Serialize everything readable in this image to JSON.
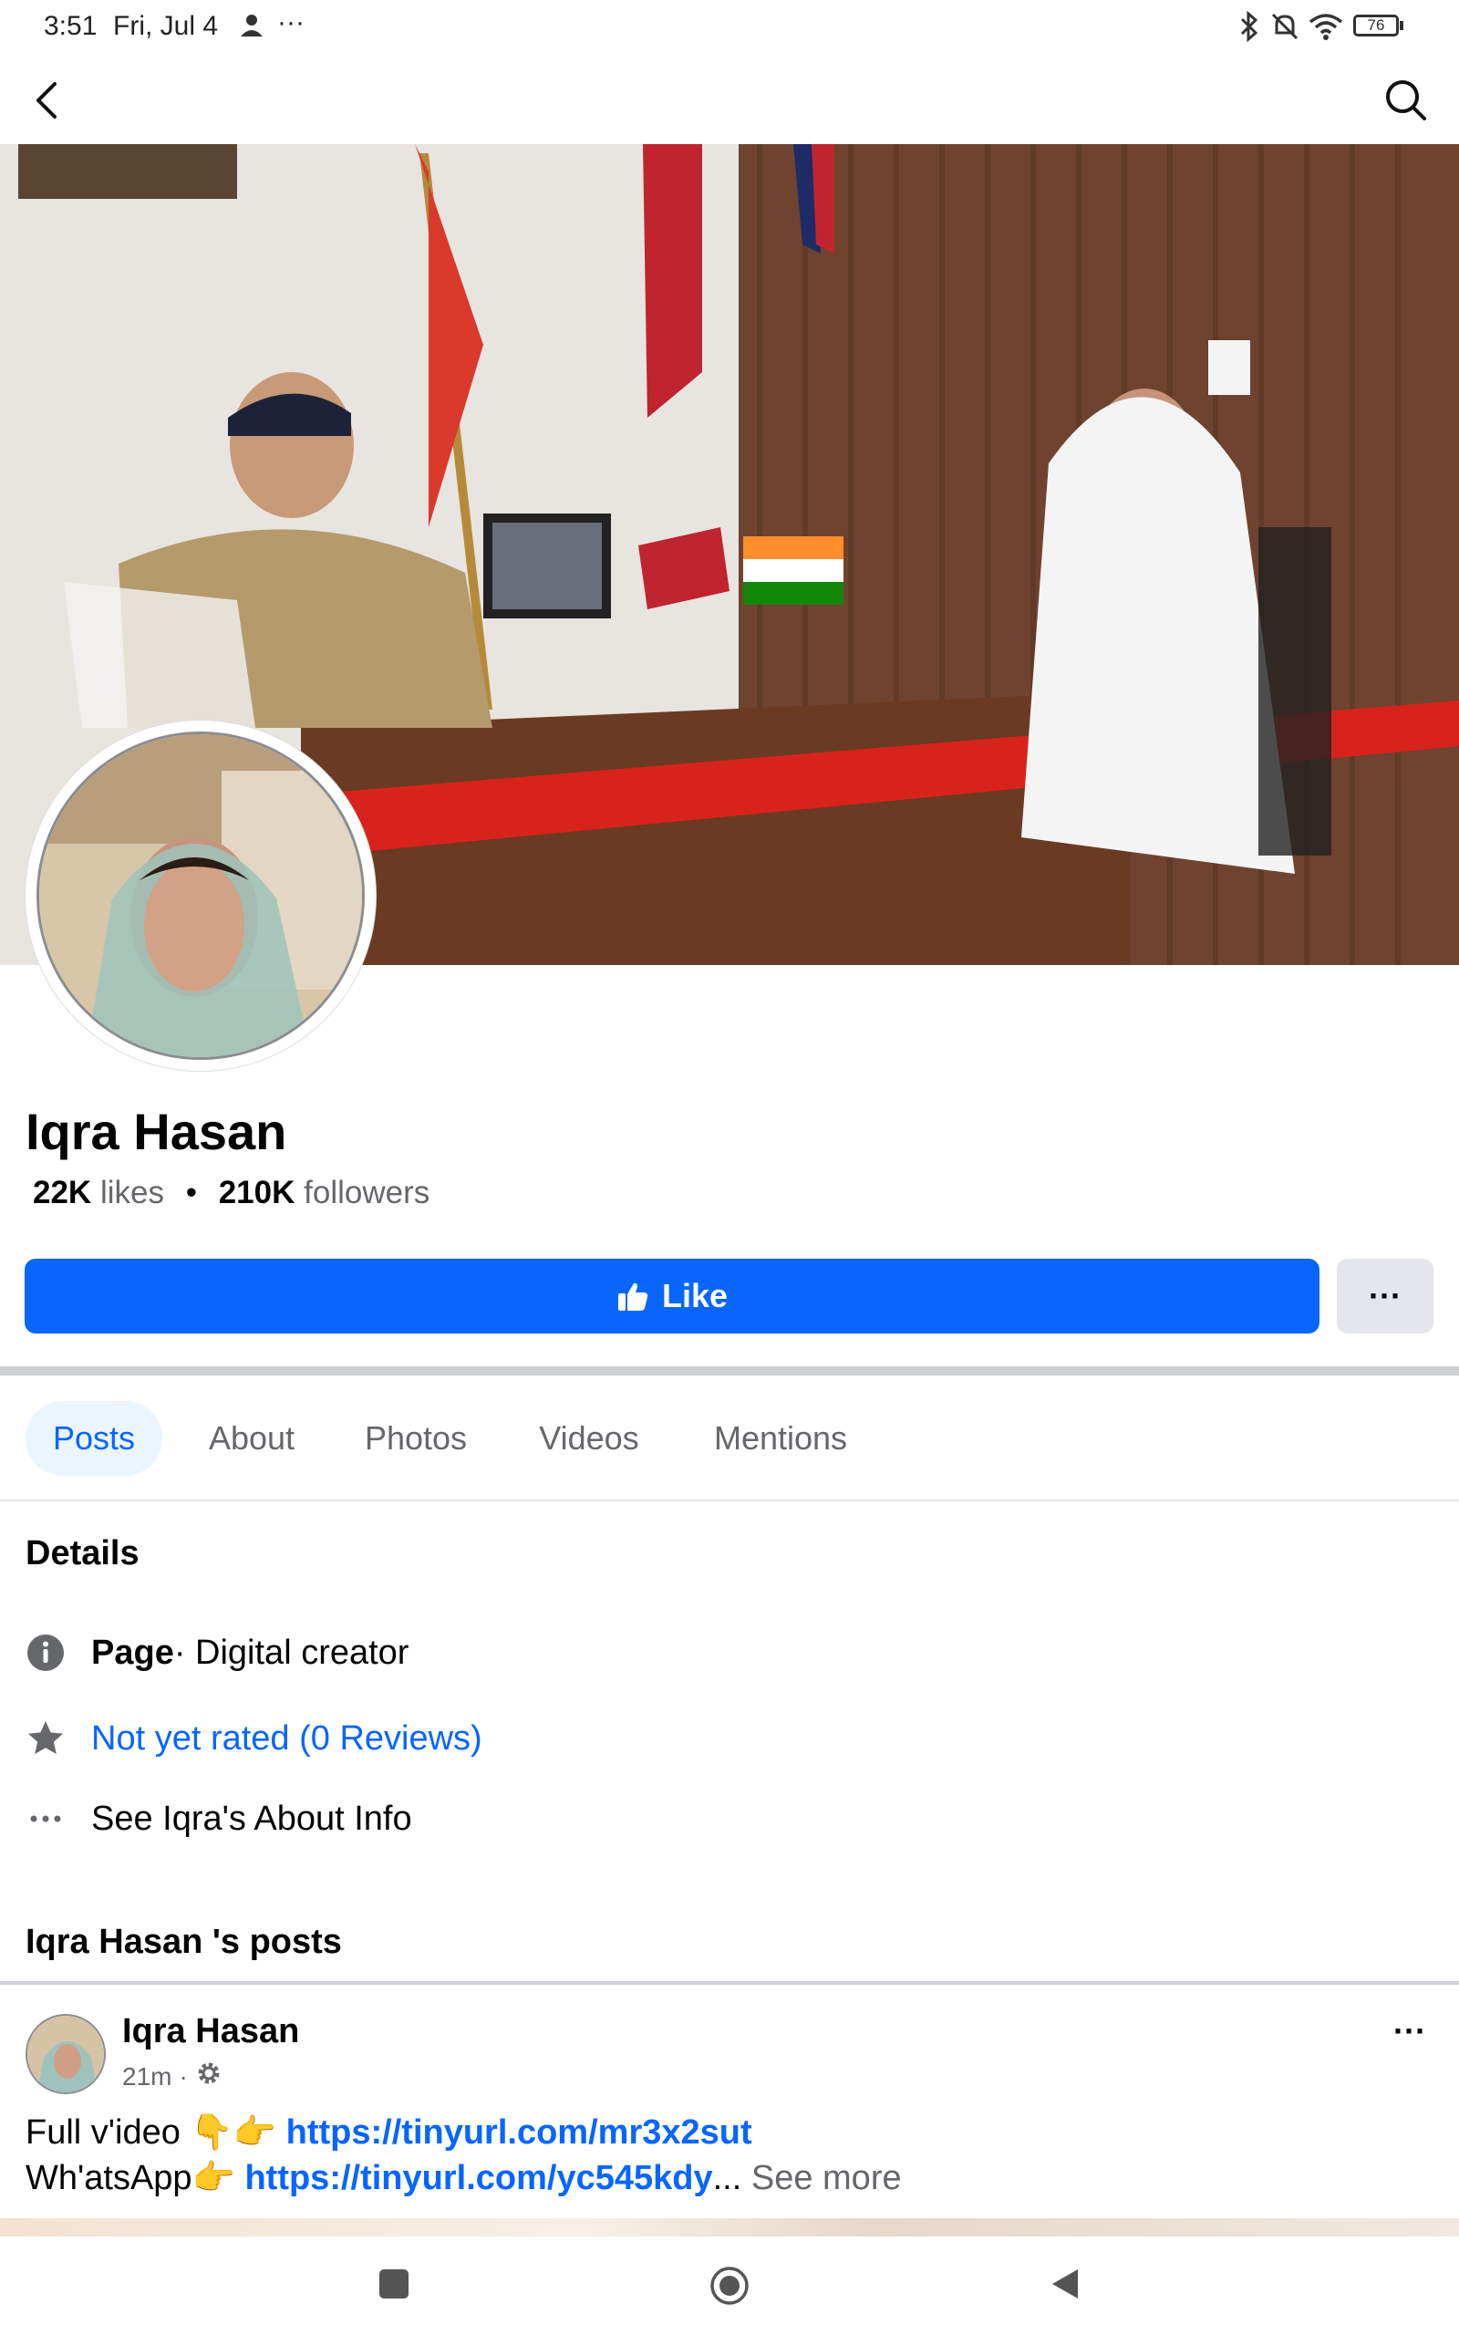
{
  "status_bar": {
    "time": "3:51",
    "date": "Fri, Jul 4",
    "more": "···",
    "battery": "76"
  },
  "profile": {
    "name": "Iqra Hasan",
    "likes_count": "22K",
    "likes_label": "likes",
    "separator": "•",
    "followers_count": "210K",
    "followers_label": "followers"
  },
  "actions": {
    "like_label": "Like",
    "more_label": "···"
  },
  "tabs": [
    {
      "label": "Posts",
      "active": true
    },
    {
      "label": "About",
      "active": false
    },
    {
      "label": "Photos",
      "active": false
    },
    {
      "label": "Videos",
      "active": false
    },
    {
      "label": "Mentions",
      "active": false
    }
  ],
  "details": {
    "title": "Details",
    "page_bold": "Page",
    "page_category": " · Digital creator",
    "rating": "Not yet rated (0 Reviews)",
    "about_link": "See Iqra's About Info"
  },
  "posts_section": {
    "title": "Iqra Hasan 's posts"
  },
  "post": {
    "author": "Iqra Hasan",
    "time": "21m",
    "meta_sep": "·",
    "line1_text": "Full v'ideo ",
    "line1_emoji": "👇👉",
    "line1_link": "https://tinyurl.com/mr3x2sut",
    "line2_text": "Wh'atsApp",
    "line2_emoji": "👉",
    "line2_link": "https://tinyurl.com/yc545kdy",
    "ellipsis": "...",
    "see_more": "See more",
    "menu": "···"
  },
  "colors": {
    "accent": "#0866ff",
    "muted": "#65676b",
    "tab_active_bg": "#ebf5ff"
  }
}
